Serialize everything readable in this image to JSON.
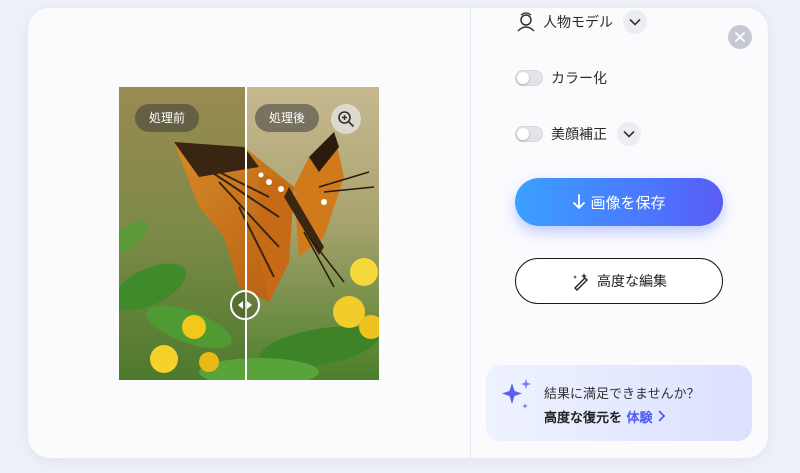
{
  "comparison": {
    "before_label": "処理前",
    "after_label": "処理後"
  },
  "options": {
    "model_label": "人物モデル",
    "colorize_label": "カラー化",
    "beautify_label": "美顔補正"
  },
  "actions": {
    "save_label": "画像を保存",
    "advanced_edit_label": "高度な編集"
  },
  "promo": {
    "line1": "結果に満足できませんか？",
    "line2_prefix": "高度な復元を",
    "line2_link": "体験"
  },
  "colors": {
    "accent": "#4d73ff",
    "promo_accent": "#4d5cf6",
    "toggle_off": "#e3e4e8"
  },
  "icons": [
    "zoom-in-icon",
    "split-handle-icon",
    "close-icon",
    "person-model-icon",
    "chevron-down-icon",
    "download-arrow-icon",
    "magic-pen-icon",
    "sparkle-icon",
    "chevron-right-icon"
  ]
}
